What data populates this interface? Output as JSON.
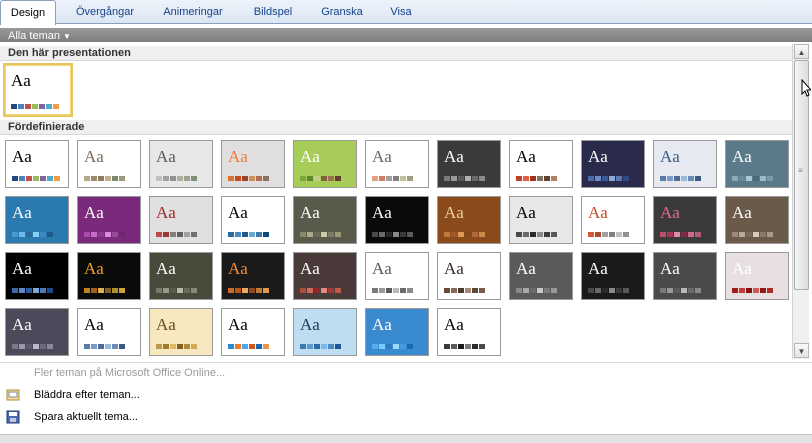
{
  "tabs": [
    "Design",
    "Övergångar",
    "Animeringar",
    "Bildspel",
    "Granska",
    "Visa"
  ],
  "gallery": {
    "filter_label": "Alla teman",
    "current_section": "Den här presentationen",
    "builtin_section": "Fördefinierade",
    "sample_text": "Aa",
    "current_theme": {
      "bg": "#ffffff",
      "fg": "#000000",
      "swatches": [
        "#1f497d",
        "#4f81bd",
        "#c0504d",
        "#9bbb59",
        "#8064a2",
        "#4bacc6",
        "#f79646"
      ]
    },
    "themes": [
      {
        "bg": "#ffffff",
        "fg": "#000000",
        "swatches": [
          "#1f497d",
          "#4f81bd",
          "#c0504d",
          "#9bbb59",
          "#8064a2",
          "#4bacc6",
          "#f79646"
        ]
      },
      {
        "bg": "#ffffff",
        "fg": "#7a6a5a",
        "swatches": [
          "#b8a88a",
          "#9b8a6b",
          "#8c7b60",
          "#c3b091",
          "#7a8a6a",
          "#9a9a7a"
        ]
      },
      {
        "bg": "#e8e8e8",
        "fg": "#5a5a5a",
        "swatches": [
          "#c0c0c0",
          "#a0a0a0",
          "#909090",
          "#b0b0a0",
          "#a0a090",
          "#80907a"
        ]
      },
      {
        "bg": "#e0dede",
        "fg": "#f07a3a",
        "swatches": [
          "#e07030",
          "#c05020",
          "#a04020",
          "#d09060",
          "#b07050",
          "#907060"
        ]
      },
      {
        "bg": "#a8cc5a",
        "fg": "#ffffff",
        "swatches": [
          "#7aaa3a",
          "#5a8a2a",
          "#c0d080",
          "#806040",
          "#a07050",
          "#604030"
        ]
      },
      {
        "bg": "#ffffff",
        "fg": "#666666",
        "swatches": [
          "#e8a080",
          "#d08060",
          "#a0a0a0",
          "#808080",
          "#c0c0a0",
          "#a0a080"
        ]
      },
      {
        "bg": "#3a3a3a",
        "fg": "#ffffff",
        "swatches": [
          "#7a7a7a",
          "#9a9a9a",
          "#5a5a5a",
          "#b0b0b0",
          "#6a6a6a",
          "#8a8a8a"
        ]
      },
      {
        "bg": "#ffffff",
        "fg": "#000000",
        "swatches": [
          "#c0402a",
          "#e06040",
          "#a03020",
          "#807060",
          "#604030",
          "#b08060"
        ]
      },
      {
        "bg": "#2a2a4a",
        "fg": "#ffffff",
        "swatches": [
          "#4a6aaa",
          "#6a8aca",
          "#3a5a9a",
          "#8aaada",
          "#5a7aba",
          "#2a4a8a"
        ]
      },
      {
        "bg": "#e6eaf0",
        "fg": "#3a5a8a",
        "swatches": [
          "#5a7aaa",
          "#7a9aca",
          "#4a6a9a",
          "#9abada",
          "#6a8aba",
          "#3a5a8a"
        ]
      },
      {
        "bg": "#5a7a8a",
        "fg": "#ffffff",
        "swatches": [
          "#8aaaba",
          "#6a8a9a",
          "#aacada",
          "#4a6a7a",
          "#9abaca",
          "#7a9aaa"
        ]
      },
      {
        "bg": "#2a7ab0",
        "fg": "#ffffff",
        "swatches": [
          "#4a9ad0",
          "#6abaf0",
          "#2a6a9a",
          "#8ad0f0",
          "#3a8ac0",
          "#1a5a8a"
        ]
      },
      {
        "bg": "#7a2a7a",
        "fg": "#ffffff",
        "swatches": [
          "#aa4aaa",
          "#ca6aca",
          "#8a3a8a",
          "#da8ada",
          "#9a4a9a",
          "#6a2a6a"
        ]
      },
      {
        "bg": "#e0e0e0",
        "fg": "#a02a2a",
        "swatches": [
          "#c04a4a",
          "#a03a3a",
          "#808080",
          "#606060",
          "#a0a0a0",
          "#707070"
        ]
      },
      {
        "bg": "#ffffff",
        "fg": "#000000",
        "swatches": [
          "#2a6aa0",
          "#4a8ac0",
          "#1a5a90",
          "#6aaad0",
          "#3a7ab0",
          "#0a4a80"
        ]
      },
      {
        "bg": "#5a5a4a",
        "fg": "#ffffff",
        "swatches": [
          "#8a8a6a",
          "#aaaa8a",
          "#6a6a5a",
          "#cacaaa",
          "#7a7a6a",
          "#9a9a7a"
        ]
      },
      {
        "bg": "#0a0a0a",
        "fg": "#ffffff",
        "swatches": [
          "#4a4a4a",
          "#6a6a6a",
          "#2a2a2a",
          "#8a8a8a",
          "#3a3a3a",
          "#5a5a5a"
        ]
      },
      {
        "bg": "#8a4a1a",
        "fg": "#f0d0a0",
        "swatches": [
          "#c07a3a",
          "#a05a2a",
          "#e09a5a",
          "#804a1a",
          "#b06a3a",
          "#d08a4a"
        ]
      },
      {
        "bg": "#e8e8e8",
        "fg": "#000000",
        "swatches": [
          "#4a4a4a",
          "#6a6a6a",
          "#2a2a2a",
          "#8a8a8a",
          "#3a3a3a",
          "#5a5a5a"
        ]
      },
      {
        "bg": "#ffffff",
        "fg": "#c04a2a",
        "swatches": [
          "#d05a3a",
          "#b04a2a",
          "#a0a0a0",
          "#808080",
          "#c0c0c0",
          "#909090"
        ]
      },
      {
        "bg": "#3a3a3a",
        "fg": "#e06a8a",
        "swatches": [
          "#c04a6a",
          "#a03a5a",
          "#e08aaa",
          "#802a4a",
          "#d06a8a",
          "#b05a7a"
        ]
      },
      {
        "bg": "#6a5a4a",
        "fg": "#ffffff",
        "swatches": [
          "#9a8a7a",
          "#baaa9a",
          "#7a6a5a",
          "#dacaba",
          "#8a7a6a",
          "#aa9a8a"
        ]
      },
      {
        "bg": "#000000",
        "fg": "#ffffff",
        "swatches": [
          "#3a6aaa",
          "#5a8aca",
          "#2a5a9a",
          "#7aaada",
          "#4a7aba",
          "#1a4a8a"
        ]
      },
      {
        "bg": "#0a0a0a",
        "fg": "#f0a02a",
        "swatches": [
          "#c0801a",
          "#a0601a",
          "#e0b04a",
          "#806020",
          "#b0902a",
          "#d0a03a"
        ]
      },
      {
        "bg": "#4a4a3a",
        "fg": "#ffffff",
        "swatches": [
          "#7a7a6a",
          "#9a9a8a",
          "#5a5a4a",
          "#babaaa",
          "#6a6a5a",
          "#8a8a7a"
        ]
      },
      {
        "bg": "#1a1a1a",
        "fg": "#f08a3a",
        "swatches": [
          "#d06a2a",
          "#b05a1a",
          "#f0aa5a",
          "#904a1a",
          "#c07a3a",
          "#e09a4a"
        ]
      },
      {
        "bg": "#4a3a3a",
        "fg": "#ffffff",
        "swatches": [
          "#b04a3a",
          "#d06a5a",
          "#902a2a",
          "#e08a7a",
          "#a03a3a",
          "#c05a4a"
        ]
      },
      {
        "bg": "#ffffff",
        "fg": "#5a5a5a",
        "swatches": [
          "#7a7a7a",
          "#9a9a9a",
          "#5a5a5a",
          "#bababa",
          "#6a6a6a",
          "#8a8a8a"
        ]
      },
      {
        "bg": "#ffffff",
        "fg": "#3a2a2a",
        "swatches": [
          "#6a4a3a",
          "#8a6a5a",
          "#4a3a2a",
          "#aa8a7a",
          "#5a4a3a",
          "#7a5a4a"
        ]
      },
      {
        "bg": "#5a5a5a",
        "fg": "#ffffff",
        "swatches": [
          "#8a8a8a",
          "#aaaaaa",
          "#6a6a6a",
          "#cacaca",
          "#7a7a7a",
          "#9a9a9a"
        ]
      },
      {
        "bg": "#1a1a1a",
        "fg": "#ffffff",
        "swatches": [
          "#4a4a4a",
          "#6a6a6a",
          "#2a2a2a",
          "#8a8a8a",
          "#3a3a3a",
          "#5a5a5a"
        ]
      },
      {
        "bg": "#4a4a4a",
        "fg": "#ffffff",
        "swatches": [
          "#7a7a7a",
          "#9a9a9a",
          "#5a5a5a",
          "#bababa",
          "#6a6a6a",
          "#8a8a8a"
        ]
      },
      {
        "bg": "#e8e0e0",
        "fg": "#ffffff",
        "swatches": [
          "#a01a1a",
          "#c03a3a",
          "#801010",
          "#d05a5a",
          "#901a1a",
          "#b02a2a"
        ]
      },
      {
        "bg": "#4a4a5a",
        "fg": "#ffffff",
        "swatches": [
          "#7a7a8a",
          "#9a9aaa",
          "#5a5a6a",
          "#babaca",
          "#6a6a7a",
          "#8a8a9a"
        ]
      },
      {
        "bg": "#ffffff",
        "fg": "#000000",
        "swatches": [
          "#5a7aaa",
          "#7a9aca",
          "#4a6a9a",
          "#9abada",
          "#6a8aba",
          "#3a5a8a"
        ]
      },
      {
        "bg": "#f8e8c0",
        "fg": "#6a4a1a",
        "swatches": [
          "#c09a4a",
          "#a07a2a",
          "#e0ba6a",
          "#806020",
          "#b08a3a",
          "#d0aa5a"
        ]
      },
      {
        "bg": "#ffffff",
        "fg": "#000000",
        "swatches": [
          "#2a8ad0",
          "#f07a2a",
          "#4aaaf0",
          "#d05a1a",
          "#1a6ab0",
          "#e09a4a"
        ]
      },
      {
        "bg": "#c0dcf0",
        "fg": "#1a3a5a",
        "swatches": [
          "#3a7ab0",
          "#5a9ad0",
          "#2a6aa0",
          "#7abaf0",
          "#4a8ac0",
          "#1a5a90"
        ]
      },
      {
        "bg": "#3a8ad0",
        "fg": "#ffffff",
        "swatches": [
          "#5aaaf0",
          "#7acaff",
          "#2a7ac0",
          "#9adaff",
          "#4a9ae0",
          "#1a6ab0"
        ]
      },
      {
        "bg": "#ffffff",
        "fg": "#000000",
        "swatches": [
          "#3a3a3a",
          "#5a5a5a",
          "#1a1a1a",
          "#7a7a7a",
          "#2a2a2a",
          "#4a4a4a"
        ]
      }
    ]
  },
  "menu": {
    "more_online": "Fler teman på Microsoft Office Online...",
    "browse": "Bläddra efter teman...",
    "save": "Spara aktuellt tema..."
  }
}
